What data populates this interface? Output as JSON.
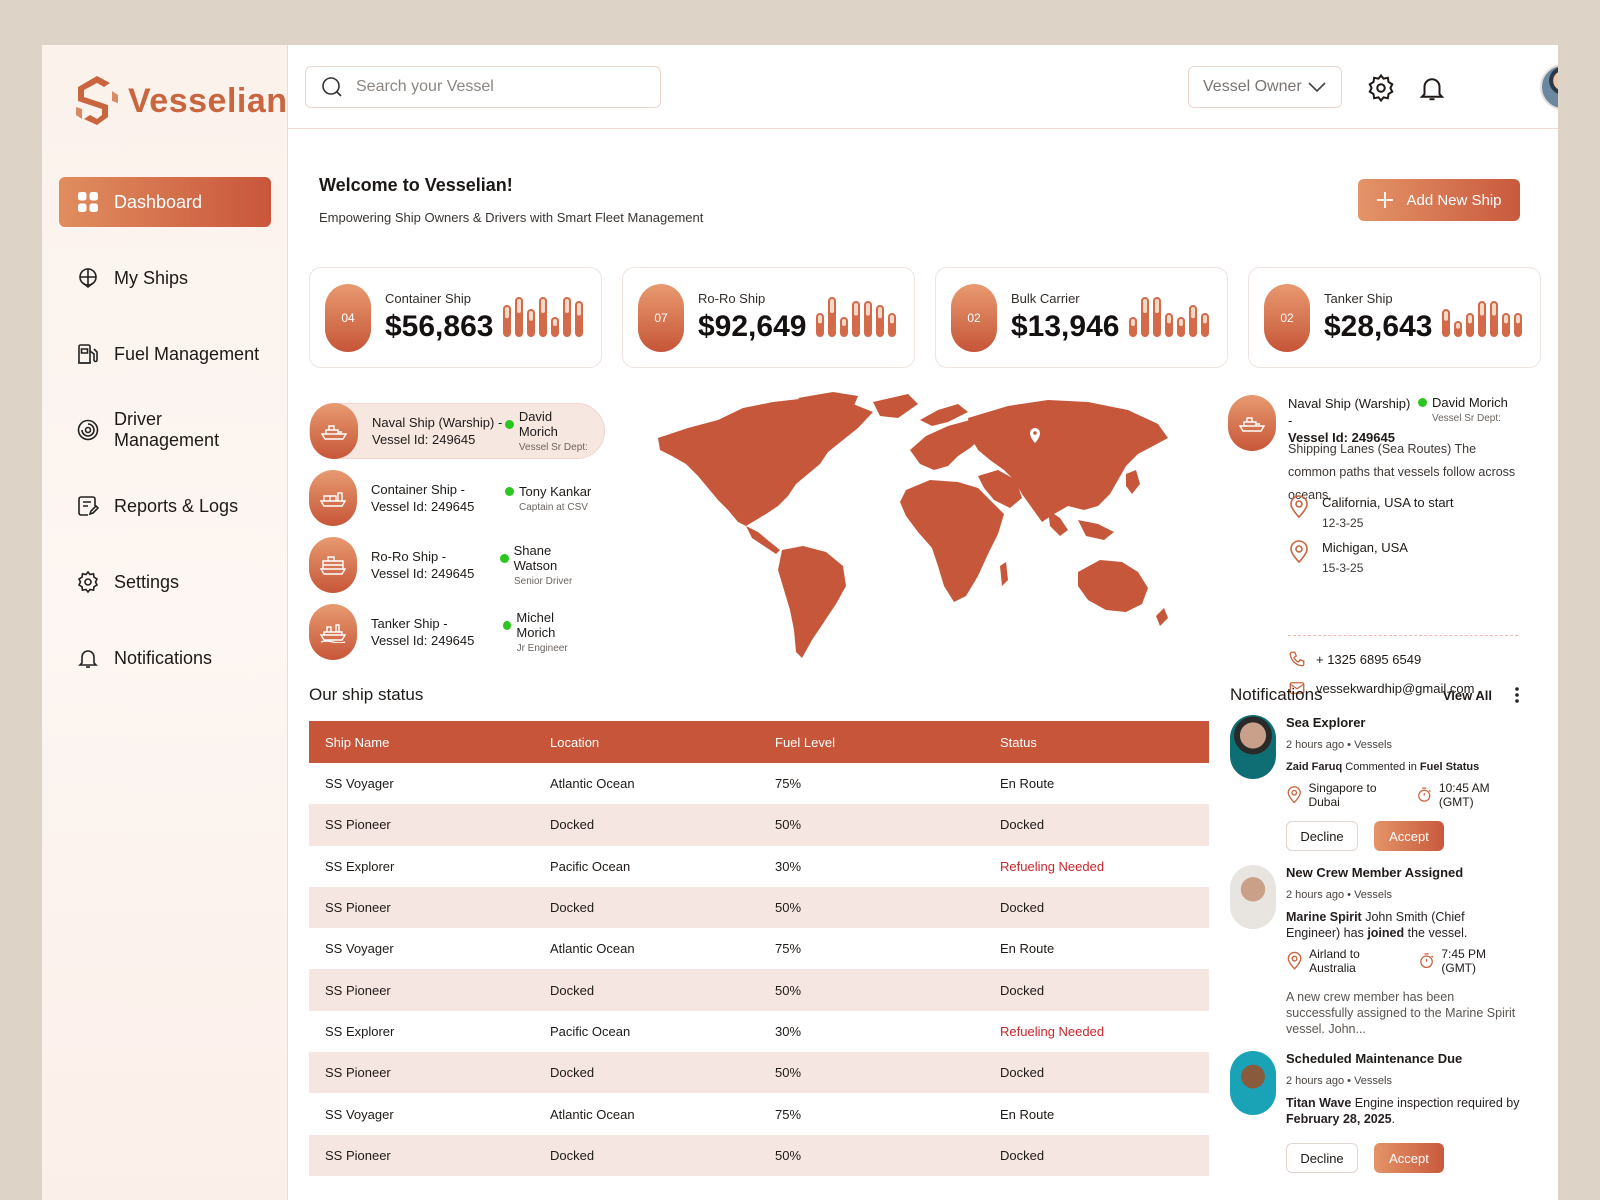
{
  "app": {
    "name": "Vesselian"
  },
  "sidebar": {
    "items": [
      {
        "label": "Dashboard",
        "icon": "dashboard-grid-icon",
        "active": true
      },
      {
        "label": "My Ships",
        "icon": "ship-icon"
      },
      {
        "label": "Fuel Management",
        "icon": "fuel-pump-icon"
      },
      {
        "label": "Driver Management",
        "icon": "steering-icon"
      },
      {
        "label": "Reports & Logs",
        "icon": "report-icon"
      },
      {
        "label": "Settings",
        "icon": "gear-icon"
      },
      {
        "label": "Notifications",
        "icon": "bell-icon"
      }
    ]
  },
  "topbar": {
    "search_placeholder": "Search your Vessel",
    "role": "Vessel Owner"
  },
  "welcome": {
    "title": "Welcome to Vesselian!",
    "subtitle": "Empowering Ship Owners & Drivers with Smart Fleet Management",
    "add_button": "Add New Ship"
  },
  "stats": [
    {
      "count": "04",
      "label": "Container Ship",
      "value": "$56,863",
      "bars": [
        0.8,
        1,
        0.7,
        1,
        0.5,
        1,
        0.9
      ]
    },
    {
      "count": "07",
      "label": "Ro-Ro Ship",
      "value": "$92,649",
      "bars": [
        0.6,
        1,
        0.5,
        0.9,
        0.9,
        0.8,
        0.6
      ]
    },
    {
      "count": "02",
      "label": "Bulk Carrier",
      "value": "$13,946",
      "bars": [
        0.5,
        1,
        1,
        0.6,
        0.5,
        0.8,
        0.6
      ]
    },
    {
      "count": "02",
      "label": "Tanker Ship",
      "value": "$28,643",
      "bars": [
        0.7,
        0.4,
        0.6,
        0.9,
        0.9,
        0.6,
        0.6
      ]
    }
  ],
  "ships": [
    {
      "name": "Naval Ship (Warship) -",
      "vessel": "Vessel Id: 249645",
      "driver": "David Morich",
      "role": "Vessel Sr Dept:"
    },
    {
      "name": "Container Ship -",
      "vessel": "Vessel Id: 249645",
      "driver": "Tony Kankar",
      "role": "Captain at CSV"
    },
    {
      "name": "Ro-Ro Ship -",
      "vessel": "Vessel Id: 249645",
      "driver": "Shane Watson",
      "role": "Senior Driver"
    },
    {
      "name": "Tanker Ship -",
      "vessel": "Vessel Id: 249645",
      "driver": "Michel Morich",
      "role": "Jr Engineer"
    }
  ],
  "route": {
    "ship": "Naval Ship (Warship) -",
    "vessel": "Vessel Id: 249645",
    "driver": "David Morich",
    "role": "Vessel Sr Dept:",
    "desc": "Shipping Lanes (Sea Routes)  The common paths that vessels follow across oceans.",
    "from": "California, USA to start",
    "from_date": "12-3-25",
    "to": "Michigan, USA",
    "to_date": "15-3-25",
    "phone": "+ 1325 6895 6549",
    "email": "vessekwardhip@gmail.com"
  },
  "table": {
    "title": "Our ship status",
    "headers": [
      "Ship Name",
      "Location",
      "Fuel Level",
      "Status"
    ],
    "rows": [
      [
        "SS Voyager",
        "Atlantic Ocean",
        "75%",
        "En Route"
      ],
      [
        "SS Pioneer",
        "Docked",
        "50%",
        "Docked"
      ],
      [
        "SS Explorer",
        "Pacific Ocean",
        "30%",
        "Refueling Needed"
      ],
      [
        "SS Pioneer",
        "Docked",
        "50%",
        "Docked"
      ],
      [
        "SS Voyager",
        "Atlantic Ocean",
        "75%",
        "En Route"
      ],
      [
        "SS Pioneer",
        "Docked",
        "50%",
        "Docked"
      ],
      [
        "SS Explorer",
        "Pacific Ocean",
        "30%",
        "Refueling Needed"
      ],
      [
        "SS Pioneer",
        "Docked",
        "50%",
        "Docked"
      ],
      [
        "SS Voyager",
        "Atlantic Ocean",
        "75%",
        "En Route"
      ],
      [
        "SS Pioneer",
        "Docked",
        "50%",
        "Docked"
      ]
    ]
  },
  "notifications": {
    "title": "Notifications",
    "view_all": "View All",
    "decline": "Decline",
    "accept": "Accept",
    "items": [
      {
        "title": "Sea Explorer",
        "meta": "2 hours ago  • Vessels",
        "user": "Zaid Faruq",
        "action": "Commented in",
        "target": "Fuel Status",
        "route": "Singapore to Dubai",
        "time": "10:45 AM (GMT)"
      },
      {
        "title": "New Crew Member Assigned",
        "meta": "2 hours ago  • Vessels",
        "vessel": "Marine Spirit",
        "msg": "John Smith (Chief Engineer) has",
        "joined": "joined",
        "msg_end": "the vessel.",
        "route": "Airland to Australia",
        "time": "7:45 PM (GMT)",
        "detail": "A new crew member has been successfully assigned to the Marine Spirit vessel. John..."
      },
      {
        "title": "Scheduled Maintenance Due",
        "meta": "2 hours ago  • Vessels",
        "vessel": "Titan Wave",
        "msg": "Engine inspection required by",
        "date": "February 28, 2025"
      }
    ]
  },
  "colors": {
    "accent": "#c65539",
    "accent_light": "#e49468",
    "alert": "#c8262c",
    "online": "#2bc61f"
  }
}
